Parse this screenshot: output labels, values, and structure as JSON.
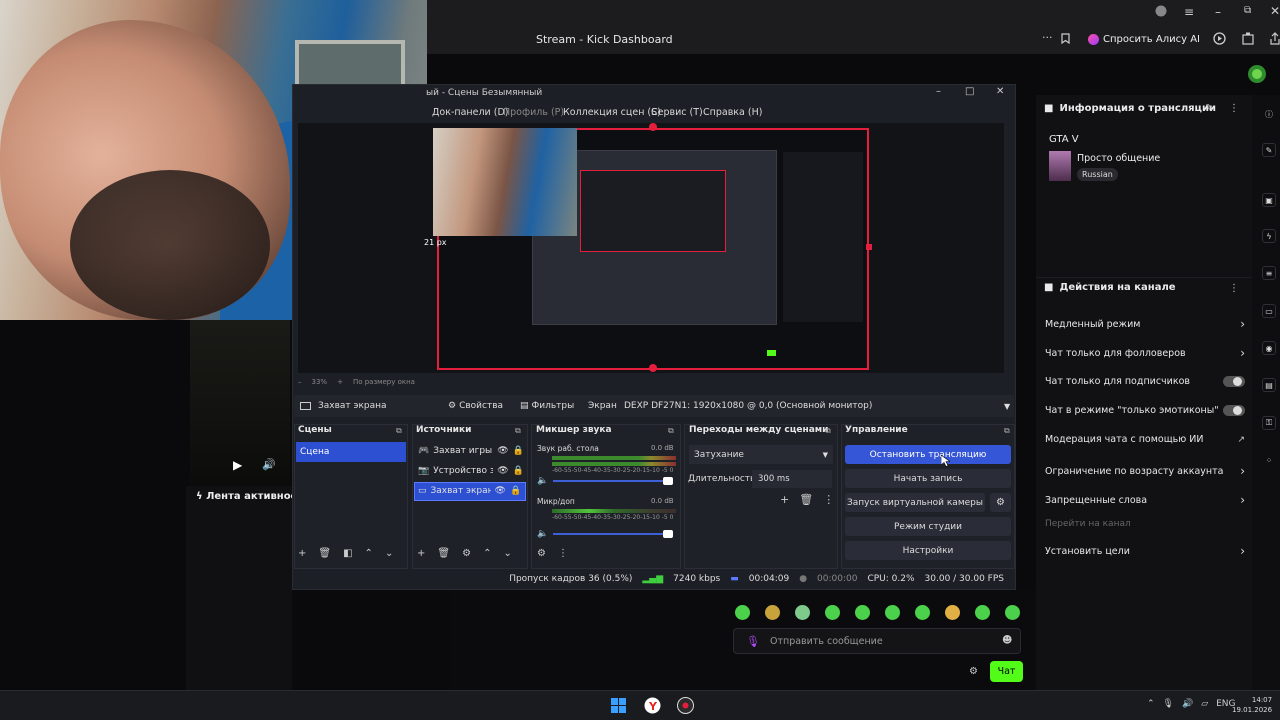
{
  "browser": {
    "title": "Stream - Kick Dashboard",
    "alice_label": "Спросить Алису AI",
    "accent": "#53fc18"
  },
  "obs": {
    "window_title": "ый - Сцены Безымянный",
    "menu": [
      "Док-панели (D)",
      "Профиль (P)",
      "Коллекция сцен (S)",
      "Сервис (T)",
      "Справка (H)"
    ],
    "size_label": "21 px",
    "zoom": "33%",
    "zoom_fit": "По размеру окна",
    "selected_source": "Захват экрана",
    "props_btn": "Свойства",
    "filters_btn": "Фильтры",
    "screen_label": "Экран",
    "monitor": "DEXP DF27N1: 1920x1080 @ 0,0 (Основной монитор)",
    "docks": {
      "scenes": "Сцены",
      "sources": "Источники",
      "mixer": "Микшер звука",
      "transitions": "Переходы между сценами",
      "controls": "Управление"
    },
    "scenes": [
      "Сцена"
    ],
    "sources": [
      "Захват игры",
      "Устройство з",
      "Захват экран"
    ],
    "mixer": [
      {
        "name": "Звук раб. стола",
        "db": "0.0 dB"
      },
      {
        "name": "Микр/доп",
        "db": "0.0 dB"
      }
    ],
    "meter_ticks": "-60-55-50-45-40-35-30-25-20-15-10 -5 0",
    "transition": "Затухание",
    "duration_label": "Длительность",
    "duration": "300 ms",
    "controls": [
      "Остановить трансляцию",
      "Начать запись",
      "Запуск виртуальной камеры",
      "Режим студии",
      "Настройки"
    ],
    "status": {
      "dropped": "Пропуск кадров 36 (0.5%)",
      "kbps": "7240 kbps",
      "stream_time": "00:04:09",
      "rec_time": "00:00:00",
      "cpu": "CPU: 0.2%",
      "fps": "30.00 / 30.00 FPS"
    }
  },
  "kick": {
    "stream_info_title": "Информация о трансляции",
    "game": "GTA V",
    "category": "Просто общение",
    "language": "Russian",
    "channel_actions_title": "Действия на канале",
    "options": [
      {
        "label": "Медленный режим",
        "kind": "arrow"
      },
      {
        "label": "Чат только для фолловеров",
        "kind": "arrow"
      },
      {
        "label": "Чат только для подписчиков",
        "kind": "toggle"
      },
      {
        "label": "Чат в режиме \"только эмотиконы\"",
        "kind": "toggle"
      },
      {
        "label": "Модерация чата с помощью ИИ",
        "kind": "external"
      },
      {
        "label": "Ограничение по возрасту аккаунта",
        "kind": "arrow"
      },
      {
        "label": "Запрещенные слова",
        "kind": "arrow"
      },
      {
        "label": "Перейти на канал",
        "kind": "muted"
      },
      {
        "label": "Установить цели",
        "kind": "arrow"
      }
    ],
    "activity_feed": "Лента активности",
    "chat_placeholder": "Отправить сообщение",
    "chat_button": "Чат"
  },
  "taskbar": {
    "lang": "ENG",
    "time": "14:07",
    "date": "19.01.2026"
  }
}
